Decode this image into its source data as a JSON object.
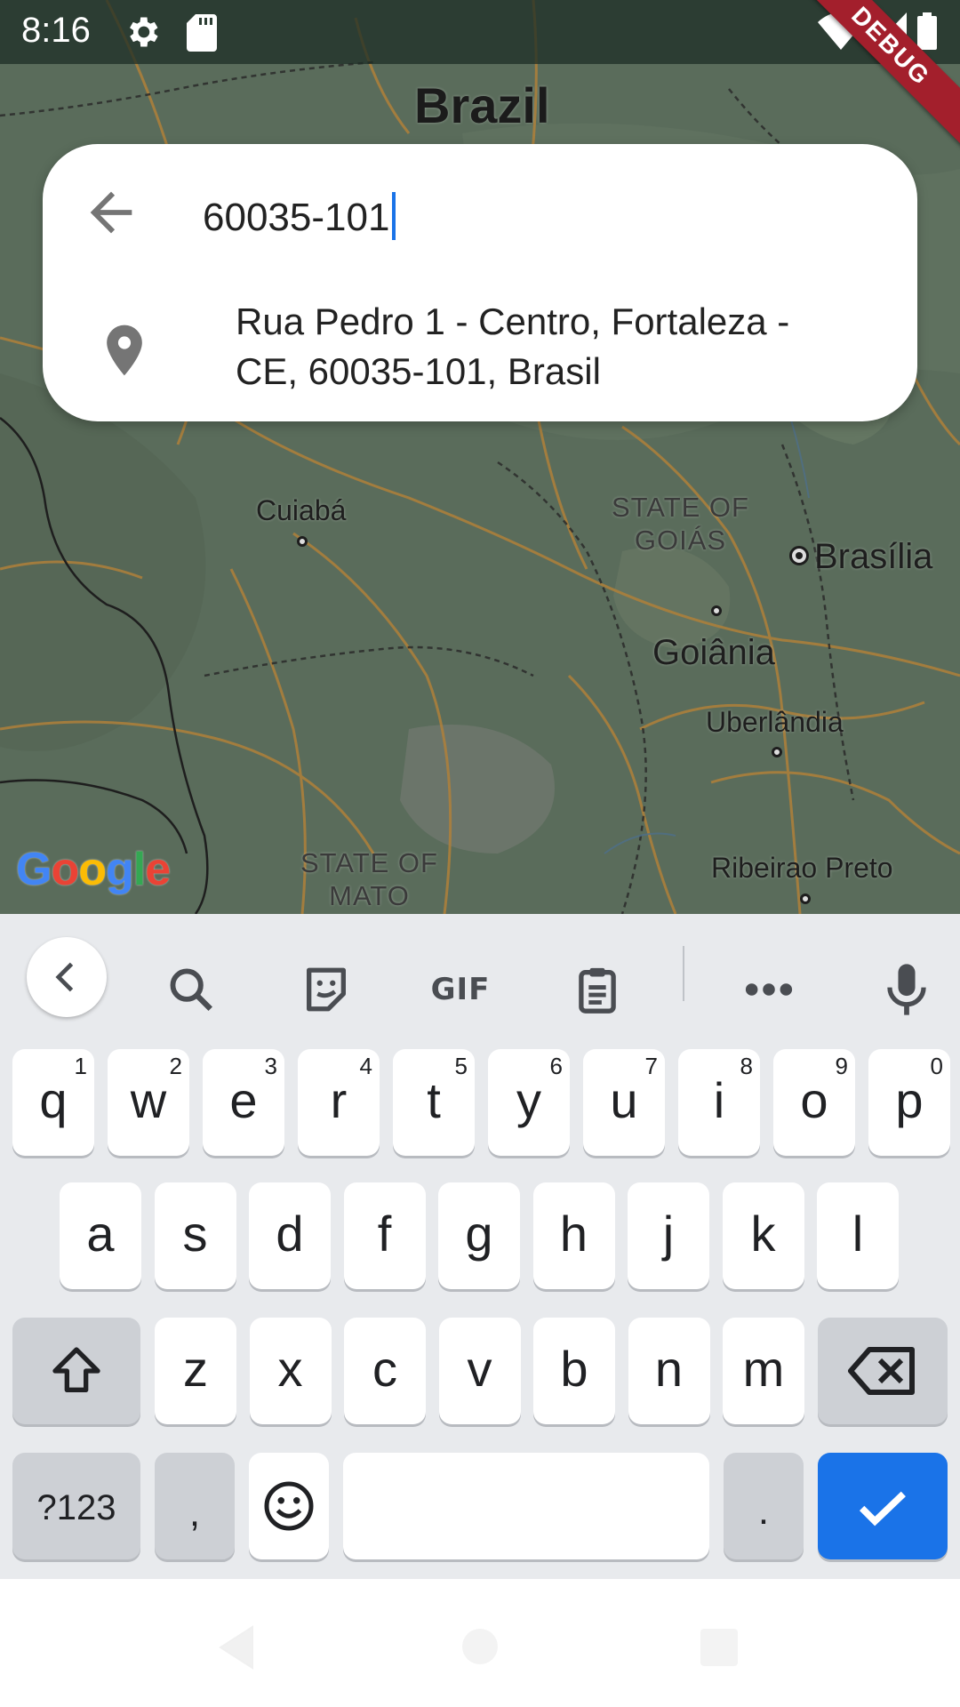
{
  "status_bar": {
    "time": "8:16",
    "icons": [
      "gear-icon",
      "sd-card-icon",
      "wifi-icon",
      "signal-icon",
      "battery-icon"
    ]
  },
  "debug_banner": "DEBUG",
  "map": {
    "country_label": "Brazil",
    "cities": {
      "cuiaba": "Cuiabá",
      "brasilia": "Brasília",
      "goiania": "Goiânia",
      "uberlandia": "Uberlândia",
      "ribeirao_preto": "Ribeirao Preto"
    },
    "states": {
      "goias_line1": "STATE OF",
      "goias_line2": "GOIÁS",
      "mato_line1": "STATE OF",
      "mato_line2": "MATO"
    },
    "attribution": "Google",
    "colors": {
      "land": "#596b5a",
      "roads": "#b0803a",
      "borders": "#2a2a2a"
    }
  },
  "search": {
    "query": "60035-101",
    "back_icon": "arrow-left-icon",
    "result": {
      "icon": "location-pin-icon",
      "line1": "Rua Pedro 1 - Centro, Fortaleza -",
      "line2": "CE, 60035-101, Brasil"
    }
  },
  "keyboard": {
    "toolbar": [
      "chevron-left-icon",
      "search-icon",
      "sticker-icon",
      "GIF",
      "clipboard-icon",
      "more-icon",
      "microphone-icon"
    ],
    "gif_label": "GIF",
    "row1": [
      {
        "k": "q",
        "s": "1"
      },
      {
        "k": "w",
        "s": "2"
      },
      {
        "k": "e",
        "s": "3"
      },
      {
        "k": "r",
        "s": "4"
      },
      {
        "k": "t",
        "s": "5"
      },
      {
        "k": "y",
        "s": "6"
      },
      {
        "k": "u",
        "s": "7"
      },
      {
        "k": "i",
        "s": "8"
      },
      {
        "k": "o",
        "s": "9"
      },
      {
        "k": "p",
        "s": "0"
      }
    ],
    "row2": [
      "a",
      "s",
      "d",
      "f",
      "g",
      "h",
      "j",
      "k",
      "l"
    ],
    "row3": [
      "z",
      "x",
      "c",
      "v",
      "b",
      "n",
      "m"
    ],
    "symbols_label": "?123",
    "comma_label": ",",
    "period_label": ".",
    "accent_color": "#1a73e8"
  },
  "nav_bar": {
    "icons": [
      "back-triangle-icon",
      "home-circle-icon",
      "recents-square-icon"
    ]
  }
}
